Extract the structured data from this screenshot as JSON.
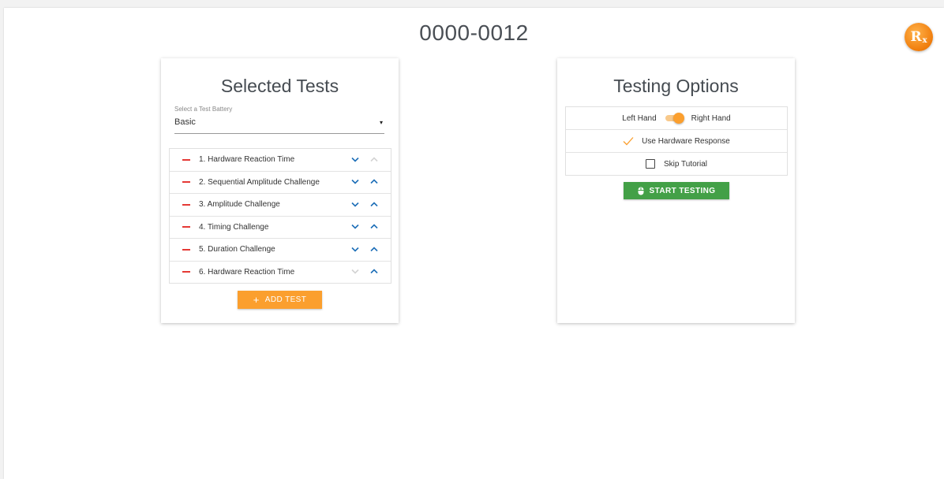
{
  "header": {
    "title": "0000-0012",
    "logo_text": "R",
    "logo_sub": "x"
  },
  "colors": {
    "orange": "#fb9f2e",
    "green": "#43a047",
    "red": "#e53935",
    "blue": "#1e6fb8"
  },
  "selected_tests": {
    "title": "Selected Tests",
    "battery_label": "Select a Test Battery",
    "battery_value": "Basic",
    "caret": "▾",
    "items": [
      {
        "label": "1. Hardware Reaction Time",
        "down_enabled": true,
        "up_enabled": false
      },
      {
        "label": "2. Sequential Amplitude Challenge",
        "down_enabled": true,
        "up_enabled": true
      },
      {
        "label": "3. Amplitude Challenge",
        "down_enabled": true,
        "up_enabled": true
      },
      {
        "label": "4. Timing Challenge",
        "down_enabled": true,
        "up_enabled": true
      },
      {
        "label": "5. Duration Challenge",
        "down_enabled": true,
        "up_enabled": true
      },
      {
        "label": "6. Hardware Reaction Time",
        "down_enabled": false,
        "up_enabled": true
      }
    ],
    "add_icon": "+",
    "add_label": "ADD TEST"
  },
  "testing_options": {
    "title": "Testing Options",
    "left_hand_label": "Left Hand",
    "right_hand_label": "Right Hand",
    "hand_selected": "Right Hand",
    "hardware_response_label": "Use Hardware Response",
    "hardware_response_checked": true,
    "skip_tutorial_label": "Skip Tutorial",
    "skip_tutorial_checked": false,
    "start_label": "START TESTING"
  },
  "icons": {
    "remove": "minus-icon",
    "move_down": "chevron-down-icon",
    "move_up": "chevron-up-icon",
    "start": "mouse-icon",
    "check": "check-icon"
  }
}
